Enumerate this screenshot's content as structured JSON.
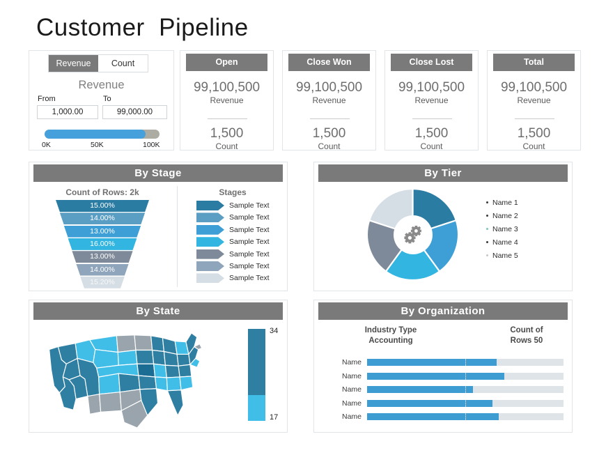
{
  "page": {
    "title": "Customer  Pipeline"
  },
  "filter": {
    "tabs": [
      {
        "label": "Revenue",
        "active": true
      },
      {
        "label": "Count",
        "active": false
      }
    ],
    "heading": "Revenue",
    "from_label": "From",
    "to_label": "To",
    "from_value": "1,000.00",
    "to_value": "99,000.00",
    "slider": {
      "fill_percent": 88,
      "ticks": [
        "0K",
        "50K",
        "100K"
      ]
    }
  },
  "kpis": [
    {
      "title": "Open",
      "revenue": "99,100,500",
      "revenue_label": "Revenue",
      "count": "1,500",
      "count_label": "Count"
    },
    {
      "title": "Close  Won",
      "revenue": "99,100,500",
      "revenue_label": "Revenue",
      "count": "1,500",
      "count_label": "Count"
    },
    {
      "title": "Close Lost",
      "revenue": "99,100,500",
      "revenue_label": "Revenue",
      "count": "1,500",
      "count_label": "Count"
    },
    {
      "title": "Total",
      "revenue": "99,100,500",
      "revenue_label": "Revenue",
      "count": "1,500",
      "count_label": "Count"
    }
  ],
  "by_stage": {
    "title": "By Stage",
    "count_label": "Count of Rows: 2k",
    "stages_label": "Stages",
    "legend_items": [
      {
        "label": "Sample Text",
        "color": "#2b7ca3"
      },
      {
        "label": "Sample Text",
        "color": "#5b9ec4"
      },
      {
        "label": "Sample Text",
        "color": "#3e9fd6"
      },
      {
        "label": "Sample Text",
        "color": "#32b5e0"
      },
      {
        "label": "Sample Text",
        "color": "#7e8a99"
      },
      {
        "label": "Sample Text",
        "color": "#8fa5bb"
      },
      {
        "label": "Sample Text",
        "color": "#d5dde5"
      }
    ]
  },
  "by_tier": {
    "title": "By Tier",
    "center_icon": "gears-icon",
    "legend": [
      {
        "label": "Name 1",
        "color": "#2b7ca3"
      },
      {
        "label": "Name 2",
        "color": "#3e9fd6"
      },
      {
        "label": "Name 3",
        "color": "#32b5e0"
      },
      {
        "label": "Name 4",
        "color": "#7e8a99"
      },
      {
        "label": "Name 5",
        "color": "#d5dde5"
      }
    ]
  },
  "by_state": {
    "title": "By State",
    "legend_high": "34",
    "legend_low": "17",
    "legend_high_color": "#2f7fa3",
    "legend_low_color": "#41bee8"
  },
  "by_organization": {
    "title": "By Organization",
    "left_header_line1": "Industry Type",
    "left_header_line2": "Accounting",
    "right_header_line1": "Count of",
    "right_header_line2": "Rows 50"
  },
  "chart_data": [
    {
      "type": "funnel",
      "title": "By Stage",
      "subtitle": "Count of Rows: 2k",
      "categories": [
        "Sample Text",
        "Sample Text",
        "Sample Text",
        "Sample Text",
        "Sample Text",
        "Sample Text",
        "Sample Text"
      ],
      "values": [
        15.0,
        14.0,
        13.0,
        16.0,
        13.0,
        14.0,
        15.2
      ],
      "labels": [
        "15.00%",
        "14.00%",
        "13.00%",
        "16.00%",
        "13.00%",
        "14.00%",
        "15.20%"
      ],
      "colors": [
        "#2b7ca3",
        "#5b9ec4",
        "#3e9fd6",
        "#32b5e0",
        "#7e8a99",
        "#8fa5bb",
        "#d5dde5"
      ],
      "ylabel": "",
      "xlabel": ""
    },
    {
      "type": "pie",
      "title": "By Tier",
      "categories": [
        "Name 1",
        "Name 2",
        "Name 3",
        "Name 4",
        "Name 5"
      ],
      "values": [
        20,
        20,
        20,
        20,
        20
      ],
      "colors": [
        "#2b7ca3",
        "#3e9fd6",
        "#32b5e0",
        "#7e8a99",
        "#d5dde5"
      ],
      "legend_position": "right",
      "donut": true
    },
    {
      "type": "heatmap",
      "title": "By State",
      "subtype": "choropleth-us-states",
      "legend_max": 34,
      "legend_min": 17,
      "colors": [
        "#2f7fa3",
        "#41bee8",
        "#9aa4ac"
      ]
    },
    {
      "type": "bar",
      "title": "By Organization",
      "orientation": "horizontal",
      "categories": [
        "Name",
        "Name",
        "Name",
        "Name",
        "Name"
      ],
      "values": [
        66,
        70,
        54,
        64,
        67
      ],
      "ylim": [
        0,
        100
      ],
      "xlabel": "Count of Rows 50",
      "ylabel": "Industry Type Accounting",
      "grid": true,
      "bar_color": "#3d9cd2",
      "track_color": "#dfe4e8"
    }
  ]
}
